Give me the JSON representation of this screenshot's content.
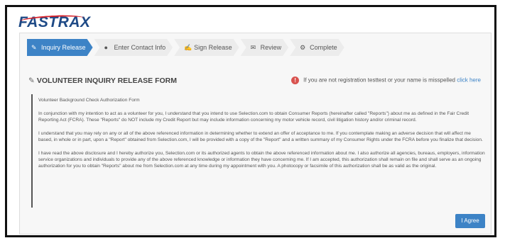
{
  "brand": {
    "logo_text": "FASTRAX"
  },
  "steps": [
    {
      "label": "Inquiry Release",
      "icon": "edit-icon",
      "active": true
    },
    {
      "label": "Enter Contact Info",
      "icon": "user-icon",
      "active": false
    },
    {
      "label": "Sign Release",
      "icon": "pen-icon",
      "active": false
    },
    {
      "label": "Review",
      "icon": "envelope-icon",
      "active": false
    },
    {
      "label": "Complete",
      "icon": "gears-icon",
      "active": false
    }
  ],
  "form": {
    "title": "VOLUNTEER INQUIRY RELEASE FORM",
    "notice": {
      "text": "If you are not registration testtest or your name is misspelled",
      "link": "click here",
      "icon": "exclamation-icon"
    },
    "paragraphs": [
      "Volunteer Background Check Authorization Form",
      "In conjunction with my intention to act as a volunteer for you, I understand that you intend to use Selection.com to obtain Consumer Reports (hereinafter called \"Reports\") about me as defined in the Fair Credit Reporting Act (FCRA). These \"Reports\" do NOT include my Credit Report but may include information concerning my motor vehicle record, civil litigation history and/or criminal record.",
      "I understand that you may rely on any or all of the above referenced information in determining whether to extend an offer of acceptance to me. If you contemplate making an adverse decision that will affect me based, in whole or in part, upon a \"Report\" obtained from Selection.com, I will be provided with a copy of the \"Report\" and a written summary of my Consumer Rights under the FCRA before you finalize that decision.",
      "I have read the above disclosure and I hereby authorize you, Selection.com or its authorized agents to obtain the above referenced information about me. I also authorize all agencies, bureaus, employers, information service organizations and individuals to provide any of the above referenced knowledge or information they have concerning me. If I am accepted, this authorization shall remain on file and shall serve as an ongoing authorization for you to obtain \"Reports\" about me from Selection.com at any time during my appointment with you. A photocopy or facsimile of this authorization shall be as valid as the original."
    ],
    "agree_label": "I Agree"
  },
  "colors": {
    "accent": "#3d83c6",
    "brand": "#1e4a86",
    "alert": "#d9534f"
  }
}
